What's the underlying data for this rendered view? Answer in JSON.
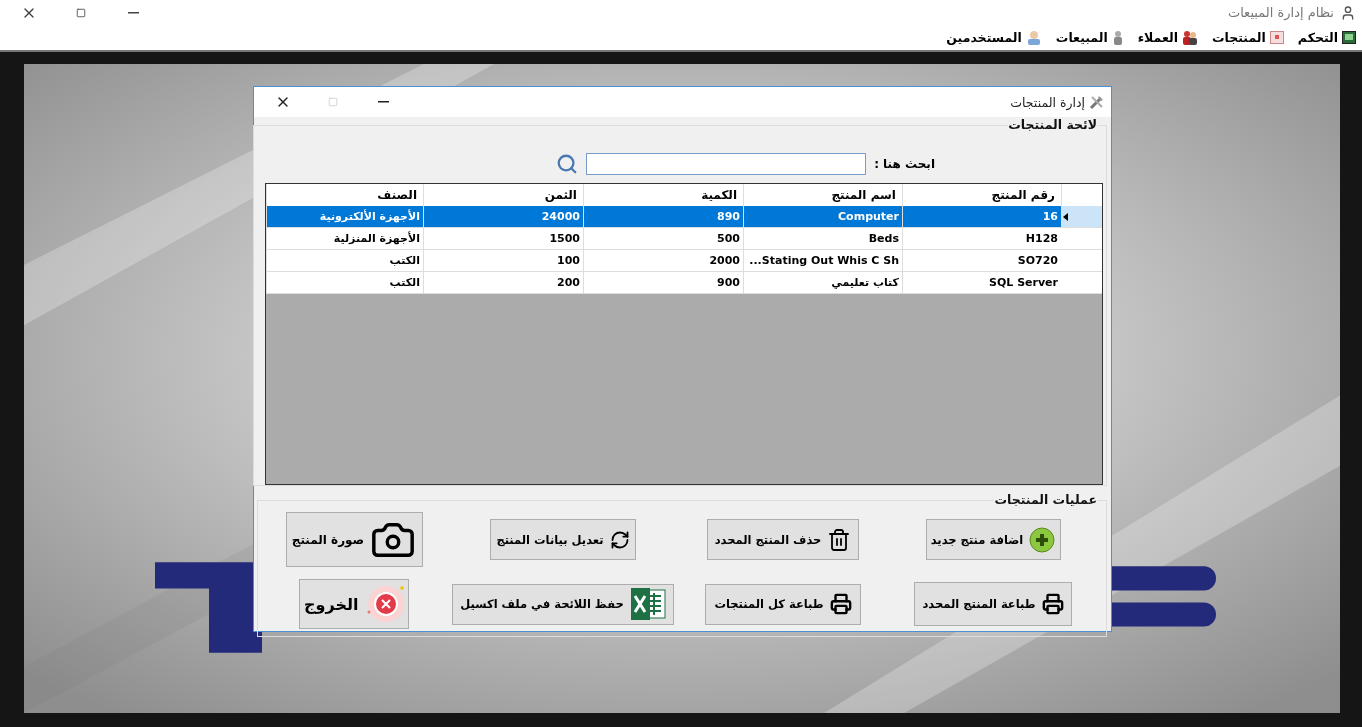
{
  "app": {
    "title": "نظام إدارة المبيعات"
  },
  "menu": [
    {
      "label": "التحكم",
      "kind": "panel"
    },
    {
      "label": "المنتجات",
      "kind": "products"
    },
    {
      "label": "العملاء",
      "kind": "customers"
    },
    {
      "label": "المبيعات",
      "kind": "sales"
    },
    {
      "label": "المستخدمين",
      "kind": "users"
    }
  ],
  "dialog": {
    "title": "إدارة المنتجات",
    "list_group": {
      "title": "لائحة المنتجات",
      "search": {
        "label": "ابحث هنا :"
      },
      "table": {
        "columns": [
          "رقم المنتج",
          "اسم المنتج",
          "الكمية",
          "الثمن",
          "الصنف"
        ],
        "rows": [
          {
            "cells": [
              "16",
              "Computer",
              "890",
              "24000",
              "الأجهزة الألكترونية"
            ],
            "selected": true
          },
          {
            "cells": [
              "H128",
              "Beds",
              "500",
              "1500",
              "الأجهزة المنزلية"
            ],
            "selected": false
          },
          {
            "cells": [
              "SO720",
              "Stating Out Whis C Sh...",
              "2000",
              "100",
              "الكتب"
            ],
            "selected": false
          },
          {
            "cells": [
              "SQL Server",
              "كتاب تعليمي",
              "900",
              "200",
              "الكتب"
            ],
            "selected": false
          }
        ]
      }
    },
    "actions_group": {
      "title": "عمليات المنتجات",
      "buttons": [
        {
          "label": "اضافة منتج جديد",
          "kind": "add"
        },
        {
          "label": "حذف المنتج المحدد",
          "kind": "delete"
        },
        {
          "label": "تعديل بيانات المنتج",
          "kind": "edit"
        },
        {
          "label": "صورة المنتج"
        },
        {
          "label": "طباعة المنتج المحدد",
          "kind": "print"
        },
        {
          "label": "طباعة كل المنتجات",
          "kind": "print"
        },
        {
          "label": "حفظ اللائحة في ملف اكسيل",
          "kind": "excel"
        },
        {
          "label": "الخروج",
          "kind": "exit"
        }
      ]
    }
  }
}
